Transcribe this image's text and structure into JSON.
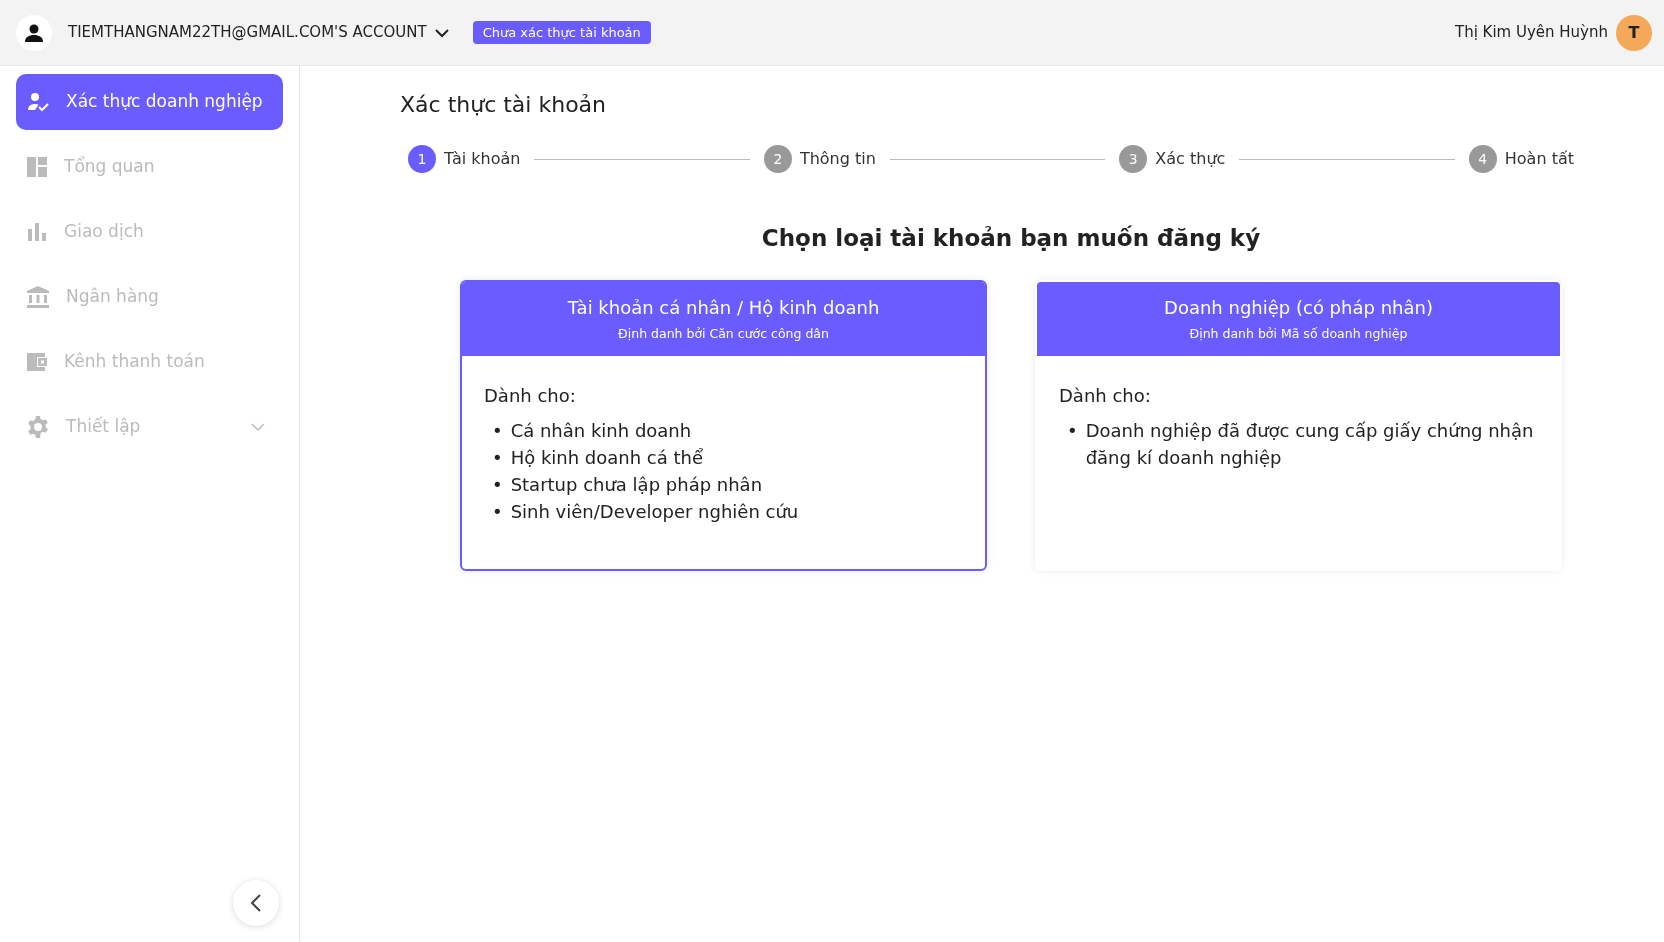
{
  "header": {
    "account": "TIEMTHANGNAM22TH@GMAIL.COM'S ACCOUNT",
    "status_badge": "Chưa xác thực tài khoản",
    "user_name": "Thị Kim Uyên Huỳnh",
    "avatar_letter": "T"
  },
  "sidebar": {
    "items": [
      {
        "label": "Xác thực doanh nghiệp",
        "selected": true,
        "expandable": false
      },
      {
        "label": "Tổng quan",
        "selected": false,
        "expandable": false
      },
      {
        "label": "Giao dịch",
        "selected": false,
        "expandable": false
      },
      {
        "label": "Ngân hàng",
        "selected": false,
        "expandable": false
      },
      {
        "label": "Kênh thanh toán",
        "selected": false,
        "expandable": false
      },
      {
        "label": "Thiết lập",
        "selected": false,
        "expandable": true
      }
    ]
  },
  "page": {
    "title": "Xác thực tài khoản",
    "steps": [
      {
        "number": "1",
        "label": "Tài khoản",
        "selected": true
      },
      {
        "number": "2",
        "label": "Thông tin",
        "selected": false
      },
      {
        "number": "3",
        "label": "Xác thực",
        "selected": false
      },
      {
        "number": "4",
        "label": "Hoàn tất",
        "selected": false
      }
    ],
    "heading": "Chọn loại tài khoản bạn muốn đăng ký",
    "cards": [
      {
        "title": "Tài khoản cá nhân / Hộ kinh doanh",
        "subtitle": "Định danh bởi Căn cước công dân",
        "intro": "Dành cho:",
        "selected": true,
        "items": [
          {
            "bullet": "•",
            "text": "Cá nhân kinh doanh"
          },
          {
            "bullet": "•",
            "text": "Hộ kinh doanh cá thể"
          },
          {
            "bullet": "•",
            "text": "Startup chưa lập pháp nhân"
          },
          {
            "bullet": "•",
            "text": "Sinh viên/Developer nghiên cứu"
          }
        ]
      },
      {
        "title": "Doanh nghiệp (có pháp nhân)",
        "subtitle": "Định danh bởi Mã số doanh nghiệp",
        "intro": "Dành cho:",
        "selected": false,
        "items": [
          {
            "bullet": "•",
            "text": "Doanh nghiệp đã được cung cấp giấy chứng nhận đăng kí doanh nghiệp"
          }
        ]
      }
    ]
  }
}
